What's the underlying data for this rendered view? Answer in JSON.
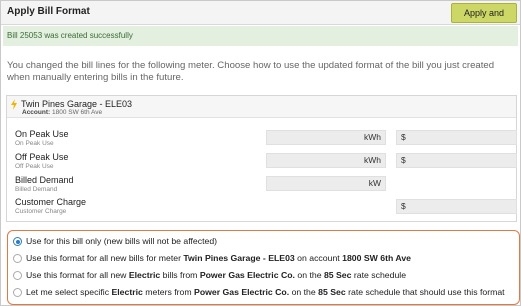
{
  "header": {
    "title": "Apply Bill Format",
    "apply_button": "Apply and Close"
  },
  "success_message": "Bill 25053 was created successfully",
  "instructions": "You changed the bill lines for the following meter. Choose how to use the updated format of the bill you just created when manually entering bills in the future.",
  "meter": {
    "name": "Twin Pines Garage - ELE03",
    "account_label": "Account:",
    "account_value": "1800 SW 6th Ave",
    "icon": "lightning-bolt-icon"
  },
  "bill_lines": [
    {
      "label": "On Peak Use",
      "sublabel": "On Peak Use",
      "unit": "kWh",
      "currency": "$"
    },
    {
      "label": "Off Peak Use",
      "sublabel": "Off Peak Use",
      "unit": "kWh",
      "currency": "$"
    },
    {
      "label": "Billed Demand",
      "sublabel": "Billed Demand",
      "unit": "kW",
      "currency": ""
    },
    {
      "label": "Customer Charge",
      "sublabel": "Customer Charge",
      "unit": "",
      "currency": "$"
    }
  ],
  "options": {
    "selected": 0,
    "o1": {
      "text": "Use for this bill only (new bills will not be affected)"
    },
    "o2": {
      "p1": "Use this format for all new bills for meter ",
      "b1": "Twin Pines Garage - ELE03",
      "p2": " on account ",
      "b2": "1800 SW 6th Ave"
    },
    "o3": {
      "p1": "Use this format for all new ",
      "b1": "Electric",
      "p2": " bills from ",
      "b2": "Power Gas Electric Co.",
      "p3": " on the ",
      "b3": "85 Sec",
      "p4": " rate schedule"
    },
    "o4": {
      "p1": "Let me select specific ",
      "b1": "Electric",
      "p2": " meters from ",
      "b2": "Power Gas Electric Co.",
      "p3": " on the ",
      "b3": "85 Sec",
      "p4": " rate schedule that should use this format"
    }
  },
  "colors": {
    "apply_button": "#cdd766",
    "success_bg": "#e3efdf",
    "options_border": "#e07a45",
    "radio_selected": "#2a7bbf",
    "bolt": "#f2b400"
  }
}
